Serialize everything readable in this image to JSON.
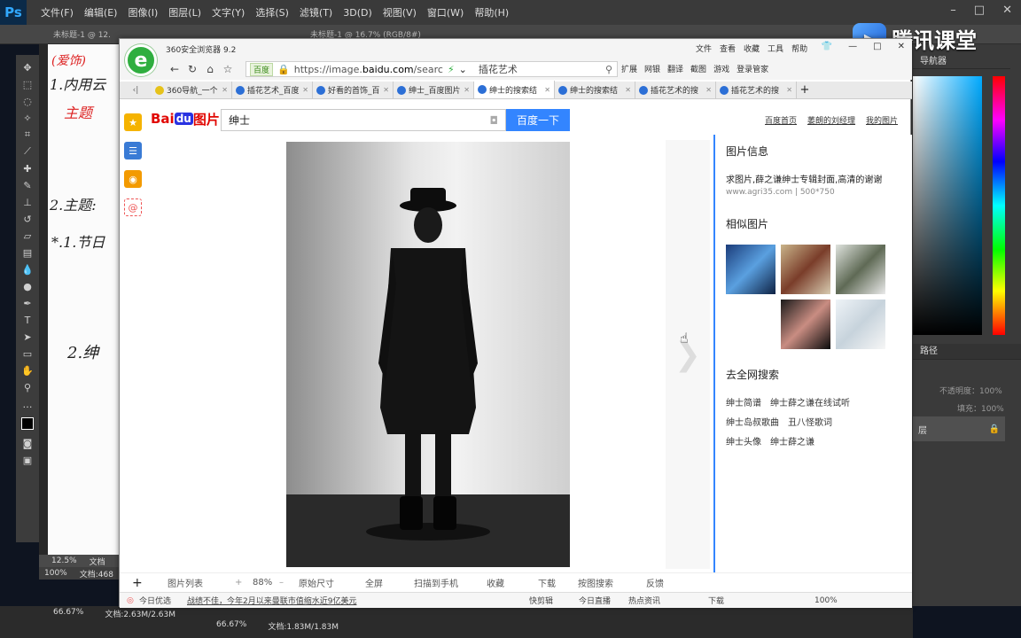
{
  "photoshop": {
    "logo": "Ps",
    "menu": [
      "文件(F)",
      "编辑(E)",
      "图像(I)",
      "图层(L)",
      "文字(Y)",
      "选择(S)",
      "滤镜(T)",
      "3D(D)",
      "视图(V)",
      "窗口(W)",
      "帮助(H)"
    ],
    "doc_tab_1": "未标题-1 @ 12.",
    "doc_tab_2": "未标题-1 @ 16.7% (RGB/8#)",
    "navigator_tab": "导航器",
    "layers_tab": "路径",
    "layer_name": "层",
    "opacity_label": "不透明度：100%",
    "fill_label": "填充：100%",
    "status_zoom": "12.5%",
    "status_doc": "文档",
    "status2_zoom": "100%",
    "status2_doc": "文档:468",
    "bottom_zoom": "66.67%",
    "bottom_doc": "文档:2.63M/2.63M",
    "bottom2_zoom": "66.67%",
    "bottom2_doc": "文档:1.83M/1.83M",
    "handwriting": [
      "(爱饰)",
      "1.内用云",
      "主题",
      "2.主题:",
      "*.1.节日",
      "2.绅"
    ]
  },
  "watermark": {
    "text": "腾讯课堂"
  },
  "browser": {
    "title": "360安全浏览器 9.2",
    "title_menus": [
      "文件",
      "查看",
      "收藏",
      "工具",
      "帮助"
    ],
    "url_badge": "百度",
    "url_prefix": "https://image.",
    "url_domain": "baidu.com",
    "url_suffix": "/searc",
    "url_search": "插花艺术",
    "tools": [
      "扩展",
      "网银",
      "翻译",
      "截图",
      "游戏",
      "登录管家"
    ],
    "tabs": [
      "360导航_一个",
      "插花艺术_百度",
      "好看的首饰_百",
      "绅士_百度图片",
      "绅士的搜索结",
      "绅士的搜索结",
      "插花艺术的搜",
      "插花艺术的搜"
    ]
  },
  "baidu": {
    "logo_text": "Bai度图片",
    "search_value": "绅士",
    "search_button": "百度一下",
    "links": [
      "百度首页",
      "萎朗的刘经理",
      "我的图片"
    ]
  },
  "panel": {
    "info_title": "图片信息",
    "desc": "求图片,薛之谦绅士专辑封面,高清的谢谢",
    "source": "www.agri35.com  |  500*750",
    "similar_title": "相似图片",
    "all_title": "去全网搜索",
    "search_links": [
      "绅士简谱",
      "绅士薛之谦在线试听",
      "绅士岛叔歌曲",
      "丑八怪歌词",
      "绅士头像",
      "绅士薛之谦"
    ]
  },
  "toolbar": {
    "plus": "+",
    "list": "图片列表",
    "zoom": "88%",
    "original": "原始尺寸",
    "fullscreen": "全屏",
    "scan": "扫描到手机",
    "fav": "收藏",
    "download": "下载",
    "search_by_image": "按图搜索",
    "feedback": "反馈"
  },
  "statusbar": {
    "today": "今日优选",
    "news": "战绩不佳，今年2月以来曼联市值缩水近9亿美元",
    "items": [
      "快剪辑",
      "今日直播",
      "热点资讯",
      "下载",
      "100%"
    ]
  },
  "colors": {
    "accent": "#3385ff",
    "browser_green": "#2fae3f",
    "ps_bg": "#3a3a3a"
  }
}
